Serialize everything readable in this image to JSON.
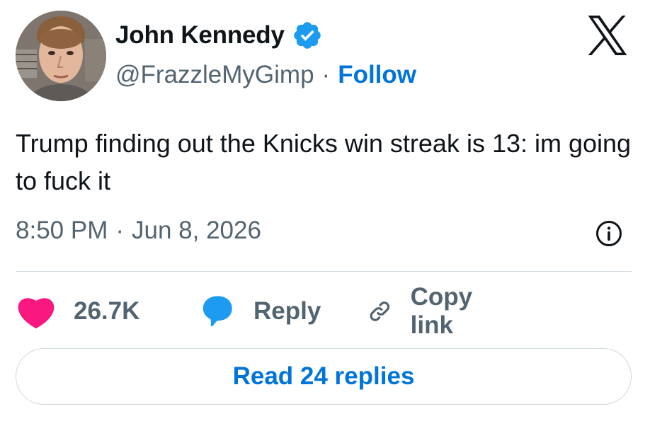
{
  "author": {
    "display_name": "John Kennedy",
    "handle": "@FrazzleMyGimp",
    "verified_icon": "verified-badge-icon",
    "avatar_icon": "avatar-photo"
  },
  "header": {
    "separator": "·",
    "follow_label": "Follow",
    "logo_icon": "x-logo-icon"
  },
  "tweet": {
    "text": "Trump finding out the Knicks win streak is 13: im going to fuck it",
    "time": "8:50 PM",
    "separator": "·",
    "date": "Jun 8, 2026",
    "info_icon": "info-icon"
  },
  "actions": {
    "like_count": "26.7K",
    "like_icon": "heart-icon",
    "reply_label": "Reply",
    "reply_icon": "speech-bubble-icon",
    "copy_label": "Copy link",
    "copy_icon": "link-icon"
  },
  "footer": {
    "read_replies_label": "Read 24 replies"
  },
  "colors": {
    "text_primary": "#0f1419",
    "text_secondary": "#536471",
    "link_blue": "#0074d9",
    "verified_blue": "#1d9bf0",
    "heart_pink": "#f91880",
    "reply_blue": "#1d9bf0",
    "divider": "#cfd9de"
  }
}
